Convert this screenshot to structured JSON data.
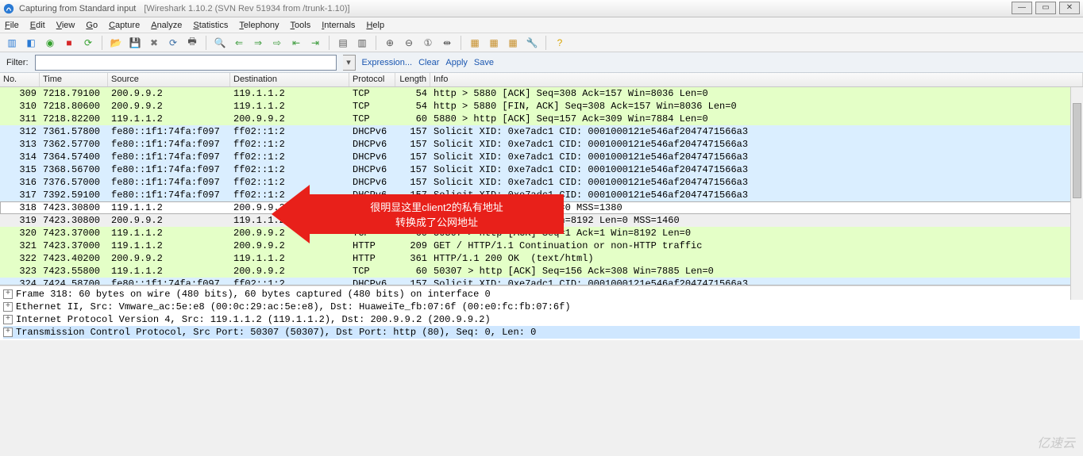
{
  "window": {
    "title_main": "Capturing from Standard input",
    "title_sub": "[Wireshark 1.10.2  (SVN Rev 51934 from /trunk-1.10)]",
    "buttons": {
      "min": "—",
      "max": "▭",
      "close": "✕"
    }
  },
  "menu": [
    "File",
    "Edit",
    "View",
    "Go",
    "Capture",
    "Analyze",
    "Statistics",
    "Telephony",
    "Tools",
    "Internals",
    "Help"
  ],
  "toolbar_icons": [
    {
      "name": "interfaces-icon",
      "glyph": "▥",
      "color": "#2a7ad4"
    },
    {
      "name": "options-icon",
      "glyph": "◧",
      "color": "#2a7ad4"
    },
    {
      "name": "start-capture-icon",
      "glyph": "◉",
      "color": "#33a02c"
    },
    {
      "name": "stop-capture-icon",
      "glyph": "■",
      "color": "#d62728"
    },
    {
      "name": "restart-capture-icon",
      "glyph": "⟳",
      "color": "#33a02c"
    },
    {
      "name": "sep"
    },
    {
      "name": "open-file-icon",
      "glyph": "📂",
      "color": "#caa24a"
    },
    {
      "name": "save-file-icon",
      "glyph": "💾",
      "color": "#3a6ea5"
    },
    {
      "name": "close-file-icon",
      "glyph": "✖",
      "color": "#777"
    },
    {
      "name": "reload-icon",
      "glyph": "⟳",
      "color": "#3a6ea5"
    },
    {
      "name": "print-icon",
      "glyph": "🖶",
      "color": "#555"
    },
    {
      "name": "sep"
    },
    {
      "name": "find-icon",
      "glyph": "🔍",
      "color": "#555"
    },
    {
      "name": "go-back-icon",
      "glyph": "⇐",
      "color": "#3a9a3a"
    },
    {
      "name": "go-forward-icon",
      "glyph": "⇒",
      "color": "#3a9a3a"
    },
    {
      "name": "go-to-icon",
      "glyph": "⇨",
      "color": "#3a9a3a"
    },
    {
      "name": "go-first-icon",
      "glyph": "⇤",
      "color": "#3a9a3a"
    },
    {
      "name": "go-last-icon",
      "glyph": "⇥",
      "color": "#3a9a3a"
    },
    {
      "name": "sep"
    },
    {
      "name": "colorize-icon",
      "glyph": "▤",
      "color": "#555"
    },
    {
      "name": "auto-scroll-icon",
      "glyph": "▥",
      "color": "#555"
    },
    {
      "name": "sep"
    },
    {
      "name": "zoom-in-icon",
      "glyph": "⊕",
      "color": "#555"
    },
    {
      "name": "zoom-out-icon",
      "glyph": "⊖",
      "color": "#555"
    },
    {
      "name": "zoom-reset-icon",
      "glyph": "①",
      "color": "#555"
    },
    {
      "name": "resize-columns-icon",
      "glyph": "⇹",
      "color": "#555"
    },
    {
      "name": "sep"
    },
    {
      "name": "capture-filters-icon",
      "glyph": "▦",
      "color": "#c78f2a"
    },
    {
      "name": "display-filters-icon",
      "glyph": "▦",
      "color": "#c78f2a"
    },
    {
      "name": "coloring-rules-icon",
      "glyph": "▦",
      "color": "#c78f2a"
    },
    {
      "name": "preferences-icon",
      "glyph": "🔧",
      "color": "#c78f2a"
    },
    {
      "name": "sep"
    },
    {
      "name": "help-icon",
      "glyph": "?",
      "color": "#d9a400"
    }
  ],
  "filter": {
    "label": "Filter:",
    "value": "",
    "links": [
      "Expression...",
      "Clear",
      "Apply",
      "Save"
    ]
  },
  "columns": [
    "No.",
    "Time",
    "Source",
    "Destination",
    "Protocol",
    "Length",
    "Info"
  ],
  "rows": [
    {
      "kind": "green",
      "no": "309",
      "time": "7218.79100",
      "src": "200.9.9.2",
      "dst": "119.1.1.2",
      "proto": "TCP",
      "len": "54",
      "info": "http > 5880 [ACK] Seq=308 Ack=157 Win=8036 Len=0"
    },
    {
      "kind": "green",
      "no": "310",
      "time": "7218.80600",
      "src": "200.9.9.2",
      "dst": "119.1.1.2",
      "proto": "TCP",
      "len": "54",
      "info": "http > 5880 [FIN, ACK] Seq=308 Ack=157 Win=8036 Len=0"
    },
    {
      "kind": "green",
      "no": "311",
      "time": "7218.82200",
      "src": "119.1.1.2",
      "dst": "200.9.9.2",
      "proto": "TCP",
      "len": "60",
      "info": "5880 > http [ACK] Seq=157 Ack=309 Win=7884 Len=0"
    },
    {
      "kind": "blue",
      "no": "312",
      "time": "7361.57800",
      "src": "fe80::1f1:74fa:f097",
      "dst": "ff02::1:2",
      "proto": "DHCPv6",
      "len": "157",
      "info": "Solicit XID: 0xe7adc1 CID: 0001000121e546af2047471566a3"
    },
    {
      "kind": "blue",
      "no": "313",
      "time": "7362.57700",
      "src": "fe80::1f1:74fa:f097",
      "dst": "ff02::1:2",
      "proto": "DHCPv6",
      "len": "157",
      "info": "Solicit XID: 0xe7adc1 CID: 0001000121e546af2047471566a3"
    },
    {
      "kind": "blue",
      "no": "314",
      "time": "7364.57400",
      "src": "fe80::1f1:74fa:f097",
      "dst": "ff02::1:2",
      "proto": "DHCPv6",
      "len": "157",
      "info": "Solicit XID: 0xe7adc1 CID: 0001000121e546af2047471566a3"
    },
    {
      "kind": "blue",
      "no": "315",
      "time": "7368.56700",
      "src": "fe80::1f1:74fa:f097",
      "dst": "ff02::1:2",
      "proto": "DHCPv6",
      "len": "157",
      "info": "Solicit XID: 0xe7adc1 CID: 0001000121e546af2047471566a3"
    },
    {
      "kind": "blue",
      "no": "316",
      "time": "7376.57000",
      "src": "fe80::1f1:74fa:f097",
      "dst": "ff02::1:2",
      "proto": "DHCPv6",
      "len": "157",
      "info": "Solicit XID: 0xe7adc1 CID: 0001000121e546af2047471566a3"
    },
    {
      "kind": "blue",
      "no": "317",
      "time": "7392.59100",
      "src": "fe80::1f1:74fa:f097",
      "dst": "ff02::1:2",
      "proto": "DHCPv6",
      "len": "157",
      "info": "Solicit XID: 0xe7adc1 CID: 0001000121e546af2047471566a3"
    },
    {
      "kind": "sel",
      "no": "318",
      "time": "7423.30800",
      "src": "119.1.1.2",
      "dst": "200.9.9.2",
      "proto": "",
      "len": "",
      "info": "YN] Seq=0 Win=8192 Len=0 MSS=1380"
    },
    {
      "kind": "grey",
      "no": "319",
      "time": "7423.30800",
      "src": "200.9.9.2",
      "dst": "119.1.1.2",
      "proto": "",
      "len": "",
      "info": "N, ACK] Seq=0 Ack=1 Win=8192 Len=0 MSS=1460"
    },
    {
      "kind": "green",
      "no": "320",
      "time": "7423.37000",
      "src": "119.1.1.2",
      "dst": "200.9.9.2",
      "proto": "TCP",
      "len": "60",
      "info": "50307 > http [ACK] Seq=1 Ack=1 Win=8192 Len=0"
    },
    {
      "kind": "green",
      "no": "321",
      "time": "7423.37000",
      "src": "119.1.1.2",
      "dst": "200.9.9.2",
      "proto": "HTTP",
      "len": "209",
      "info": "GET / HTTP/1.1 Continuation or non-HTTP traffic"
    },
    {
      "kind": "green",
      "no": "322",
      "time": "7423.40200",
      "src": "200.9.9.2",
      "dst": "119.1.1.2",
      "proto": "HTTP",
      "len": "361",
      "info": "HTTP/1.1 200 OK  (text/html)"
    },
    {
      "kind": "green",
      "no": "323",
      "time": "7423.55800",
      "src": "119.1.1.2",
      "dst": "200.9.9.2",
      "proto": "TCP",
      "len": "60",
      "info": "50307 > http [ACK] Seq=156 Ack=308 Win=7885 Len=0"
    },
    {
      "kind": "blue",
      "no": "324",
      "time": "7424.58700",
      "src": "fe80::1f1:74fa:f097",
      "dst": "ff02::1:2",
      "proto": "DHCPv6",
      "len": "157",
      "info": "Solicit XID: 0xe7adc1 CID: 0001000121e546af2047471566a3"
    }
  ],
  "details": [
    "Frame 318: 60 bytes on wire (480 bits), 60 bytes captured (480 bits) on interface 0",
    "Ethernet II, Src: Vmware_ac:5e:e8 (00:0c:29:ac:5e:e8), Dst: HuaweiTe_fb:07:6f (00:e0:fc:fb:07:6f)",
    "Internet Protocol Version 4, Src: 119.1.1.2 (119.1.1.2), Dst: 200.9.9.2 (200.9.9.2)",
    "Transmission Control Protocol, Src Port: 50307 (50307), Dst Port: http (80), Seq: 0, Len: 0"
  ],
  "annotation": {
    "line1": "很明显这里client2的私有地址",
    "line2": "转换成了公网地址"
  },
  "watermark": "亿速云"
}
